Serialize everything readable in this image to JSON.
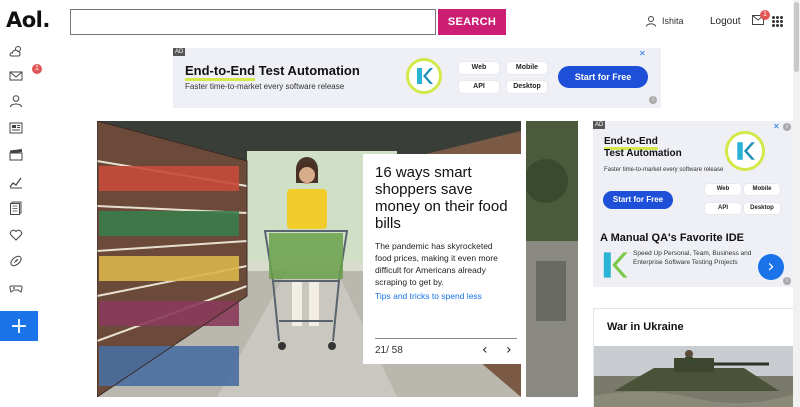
{
  "header": {
    "logo": "Aol.",
    "search_value": "",
    "search_button": "SEARCH",
    "user_name": "Ishita",
    "logout": "Logout",
    "mail_count": "1"
  },
  "sidebar": {
    "items": [
      "weather-icon",
      "mail-icon",
      "user-icon",
      "news-icon",
      "entertainment-icon",
      "finance-icon",
      "articles-icon",
      "health-icon",
      "sports-icon",
      "games-icon"
    ],
    "mail_badge": "1",
    "plus": "+"
  },
  "ad_top": {
    "label": "AD",
    "headline_a": "End-to-End",
    "headline_b": " Test Automation",
    "sub": "Faster time-to-market every software release",
    "pills": [
      "Web",
      "Mobile",
      "API",
      "Desktop"
    ],
    "cta": "Start for Free",
    "info": "i",
    "close": "✕"
  },
  "hero": {
    "title": "16 ways smart shoppers save money on their food bills",
    "description": "The pandemic has skyrocketed food prices, making it even more difficult for Americans already scraping to get by.",
    "link": "Tips and tricks to spend less",
    "counter": "21/ 58",
    "prev": "‹",
    "next": "›"
  },
  "ad_side": {
    "label": "AD",
    "headline_a": "End-to-End",
    "headline_b": "Test Automation",
    "sub": "Faster time-to-market every software release",
    "pills": [
      "Web",
      "Mobile",
      "API",
      "Desktop"
    ],
    "cta": "Start for Free",
    "title2": "A Manual QA's Favorite IDE",
    "text2": "Speed Up Personal, Team, Business and Enterprise Software Testing Projects",
    "arrow": "›",
    "info": "i",
    "close": "✕"
  },
  "war": {
    "title": "War in Ukraine"
  },
  "colors": {
    "search_button": "#cc1f73",
    "accent_blue": "#1a73e8",
    "badge_red": "#e05555",
    "ad_yellow": "#d4e84a",
    "cta_blue": "#1d4fd8"
  }
}
